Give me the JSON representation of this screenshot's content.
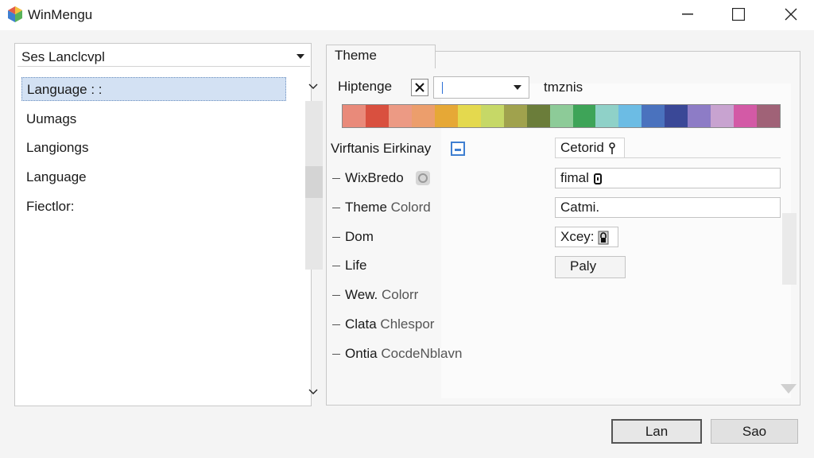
{
  "window": {
    "title": "WinMengu",
    "icon": "app-cube-icon"
  },
  "left_panel": {
    "select_value": "Ses Lanclcvpl",
    "items": [
      {
        "label": "Language : :",
        "selected": true
      },
      {
        "label": "Uumags",
        "selected": false
      },
      {
        "label": "Langiongs",
        "selected": false
      },
      {
        "label": "Language",
        "selected": false
      },
      {
        "label": "Fiectlor:",
        "selected": false
      }
    ]
  },
  "right_panel": {
    "tab_label": "Theme",
    "top_label": "Hiptenge",
    "checkbox_checked": true,
    "tmznis_label": "tmznis",
    "palette": [
      "#e98a7a",
      "#d9503f",
      "#ec9a84",
      "#ec9e6c",
      "#e6a836",
      "#e4d94e",
      "#c6d867",
      "#a0a24d",
      "#6b7d3a",
      "#8dcb98",
      "#3ea458",
      "#8fd1c8",
      "#6cbce4",
      "#4a72be",
      "#3a4897",
      "#8d7cc6",
      "#c8a3d0",
      "#d35aa6",
      "#a06277"
    ],
    "rows": [
      {
        "label": "Virftanis Eirkinay",
        "muted": "",
        "field": "Cetorid",
        "field_icon": "pin-icon"
      },
      {
        "label": "WixBredo",
        "muted": "",
        "field": "fimal",
        "field_icon": "tag-icon"
      },
      {
        "label": "Theme ",
        "muted": "Colord",
        "field": "Catmi.",
        "field_icon": ""
      },
      {
        "label": "Dom",
        "muted": "",
        "field": "Xcey:",
        "field_icon": "lock-icon"
      },
      {
        "label": "Life",
        "muted": "",
        "field": "Paly",
        "field_icon": ""
      },
      {
        "label": "Wew. ",
        "muted": "Colorr",
        "field": "",
        "field_icon": ""
      },
      {
        "label": "Clata ",
        "muted": "Chlespor",
        "field": "",
        "field_icon": ""
      },
      {
        "label": "Ontia ",
        "muted": "CocdeNblavn",
        "field": "",
        "field_icon": ""
      }
    ]
  },
  "buttons": {
    "primary": "Lan",
    "secondary": "Sao"
  }
}
